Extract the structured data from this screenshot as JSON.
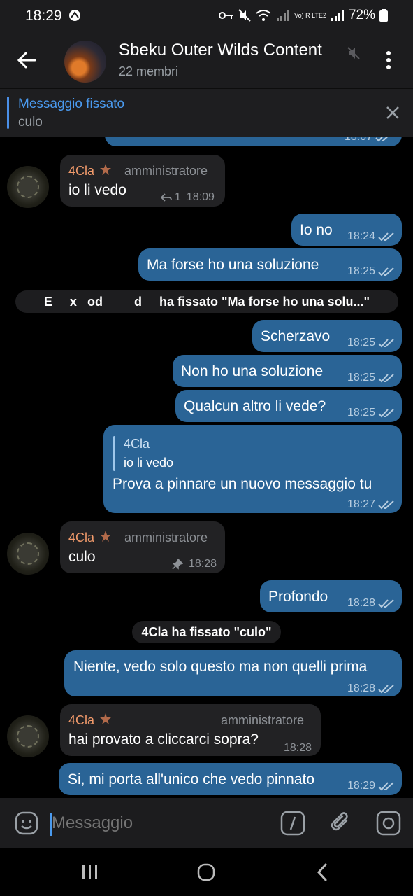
{
  "status_bar": {
    "time": "18:29",
    "battery": "72%",
    "network": "Vo) R LTE2"
  },
  "header": {
    "title": "Sbeku Outer Wilds Content",
    "subtitle": "22 membri"
  },
  "pinned": {
    "title": "Messaggio fissato",
    "text": "culo"
  },
  "top_partial_time": "18:07",
  "messages": [
    {
      "dir": "in",
      "sender": "4Cla",
      "role": "amministratore",
      "text": "io li vedo",
      "replies": "1",
      "time": "18:09"
    },
    {
      "dir": "out",
      "text": "Io no",
      "time": "18:24"
    },
    {
      "dir": "out",
      "text": "Ma forse ho una soluzione",
      "time": "18:25"
    },
    {
      "dir": "service",
      "text": "E     x   od         d     ha fissato \"Ma forse ho una solu...\""
    },
    {
      "dir": "out",
      "text": "Scherzavo",
      "time": "18:25"
    },
    {
      "dir": "out",
      "text": "Non ho una soluzione",
      "time": "18:25"
    },
    {
      "dir": "out",
      "text": "Qualcun altro li vede?",
      "time": "18:25"
    },
    {
      "dir": "out",
      "reply_name": "4Cla",
      "reply_text": "io li vedo",
      "text": "Prova a pinnare un nuovo messaggio tu",
      "time": "18:27"
    },
    {
      "dir": "in",
      "sender": "4Cla",
      "role": "amministratore",
      "text": "culo",
      "time": "18:28"
    },
    {
      "dir": "out",
      "text": "Profondo",
      "time": "18:28"
    },
    {
      "dir": "service",
      "text": "4Cla ha fissato \"culo\""
    },
    {
      "dir": "out",
      "text": "Niente, vedo solo questo ma non quelli prima",
      "time": "18:28"
    },
    {
      "dir": "in",
      "sender": "4Cla",
      "role": "amministratore",
      "text": "hai provato a cliccarci sopra?",
      "time": "18:28"
    },
    {
      "dir": "out",
      "text": "Si, mi porta all'unico che vedo pinnato",
      "time": "18:29"
    }
  ],
  "input": {
    "placeholder": "Messaggio"
  },
  "colors": {
    "outgoing_bubble": "#2a6496",
    "incoming_bubble": "#222224",
    "accent": "#4a9aef",
    "sender_name": "#f19a6b"
  },
  "icons": [
    "back-arrow-icon",
    "mute-icon",
    "more-vert-icon",
    "close-icon",
    "sticker-icon",
    "command-icon",
    "attach-icon",
    "camera-icon",
    "double-check-icon",
    "reply-icon",
    "pin-icon",
    "star-icon"
  ]
}
